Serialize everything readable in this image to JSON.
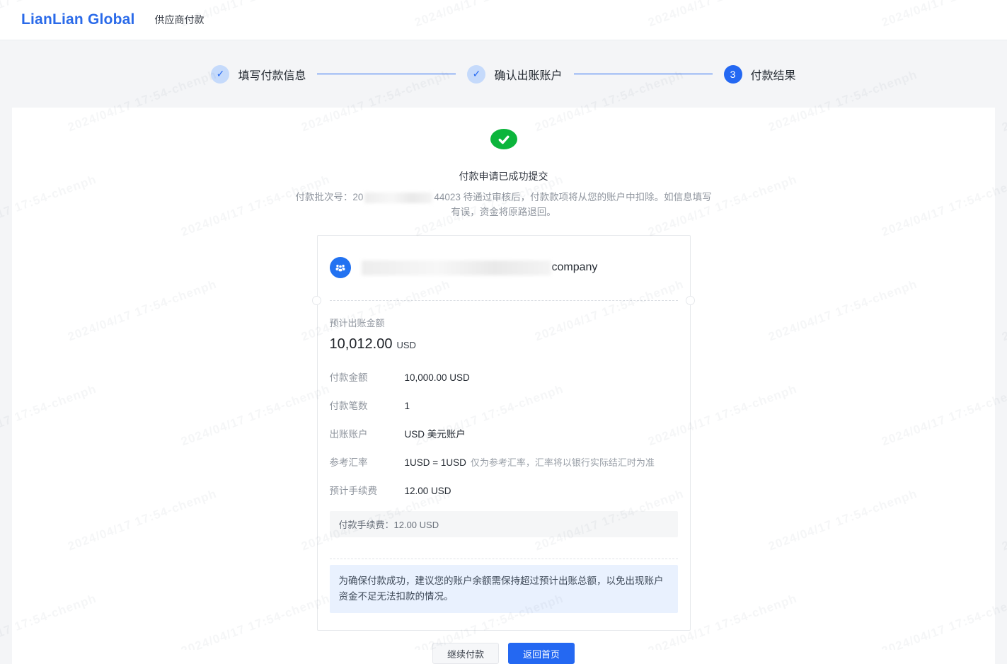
{
  "header": {
    "logo": "LianLian Global",
    "app_title": "供应商付款"
  },
  "stepper": {
    "steps": [
      {
        "label": "填写付款信息",
        "state": "done",
        "glyph": "✓"
      },
      {
        "label": "确认出账账户",
        "state": "done",
        "glyph": "✓"
      },
      {
        "label": "付款结果",
        "state": "current",
        "number": "3"
      }
    ]
  },
  "result": {
    "title": "付款申请已成功提交",
    "batch_label": "付款批次号：",
    "batch_prefix": "20",
    "batch_suffix": "44023",
    "desc": "待通过审核后，付款款项将从您的账户中扣除。如信息填写有误，资金将原路退回。"
  },
  "card": {
    "account_name_suffix": "company",
    "amount_label": "预计出账金额",
    "amount_value": "10,012.00",
    "amount_currency": "USD",
    "rows": [
      {
        "label": "付款金额",
        "value": "10,000.00 USD",
        "note": ""
      },
      {
        "label": "付款笔数",
        "value": "1",
        "note": ""
      },
      {
        "label": "出账账户",
        "value": "USD 美元账户",
        "note": ""
      },
      {
        "label": "参考汇率",
        "value": "1USD = 1USD",
        "note": "仅为参考汇率，汇率将以银行实际结汇时为准"
      },
      {
        "label": "预计手续费",
        "value": "12.00 USD",
        "note": ""
      }
    ],
    "fee_box": "付款手续费：12.00 USD",
    "notice": "为确保付款成功，建议您的账户余额需保持超过预计出账总额，以免出现账户资金不足无法扣款的情况。"
  },
  "actions": {
    "continue_label": "继续付款",
    "home_label": "返回首页"
  },
  "watermark": {
    "text": "2024/04/17 17:54-chenph"
  },
  "colors": {
    "primary_blue": "#2468f2",
    "logo_blue": "#2a6ae9",
    "success_green": "#0cb53c",
    "step_done_bg": "#c5dafb",
    "page_bg": "#f4f5f7",
    "notice_bg": "#e9f1fe",
    "fee_box_bg": "#f5f6f7",
    "text_dark": "#1f2329",
    "text_gray": "#8f959e"
  }
}
